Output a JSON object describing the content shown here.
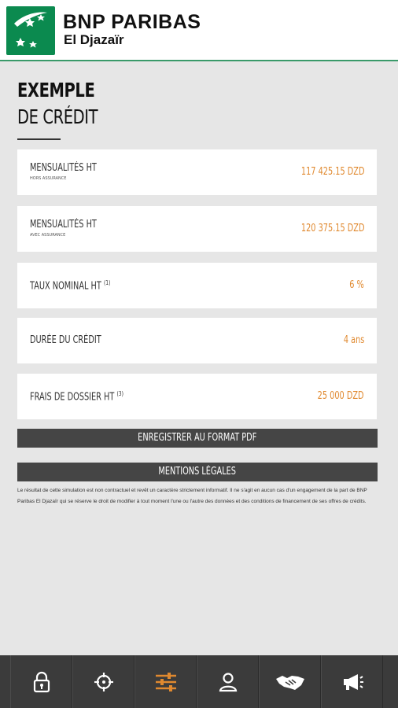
{
  "header": {
    "brand": "BNP PARIBAS",
    "subtitle": "El Djazaïr",
    "logo_icon": "bnp-stars-logo",
    "accent": "#0b8a4f"
  },
  "page": {
    "title_line1": "EXEMPLE",
    "title_line2": "DE CRÉDIT"
  },
  "results": [
    {
      "label": "Mensualités HT",
      "sublabel": "hors assurance",
      "note": "",
      "value": "117 425.15 DZD"
    },
    {
      "label": "Mensualités HT",
      "sublabel": "avec assurance",
      "note": "",
      "value": "120 375.15 DZD"
    },
    {
      "label": "Taux nominal HT",
      "sublabel": "",
      "note": "(1)",
      "value": "6 %"
    },
    {
      "label": "Durée du crédit",
      "sublabel": "",
      "note": "",
      "value": "4 ans"
    },
    {
      "label": "Frais de dossier HT",
      "sublabel": "",
      "note": "(3)",
      "value": "25 000 DZD"
    }
  ],
  "buttons": {
    "save_pdf": "Enregistrer au format PDF",
    "legal_mentions": "Mentions légales"
  },
  "legal_text": "Le résultat de cette simulation est non contractuel et revêt un caractère strictement informatif. Il ne s'agit en aucun cas d'un engagement de la part de BNP Paribas El Djazaïr qui se réserve le droit de modifier à tout moment l'une ou l'autre des données et des conditions de financement de ses offres de crédits.",
  "nav": {
    "items": [
      {
        "icon": "lock-icon",
        "active": false
      },
      {
        "icon": "crosshair-icon",
        "active": false
      },
      {
        "icon": "sliders-icon",
        "active": true
      },
      {
        "icon": "user-icon",
        "active": false
      },
      {
        "icon": "handshake-icon",
        "active": false
      },
      {
        "icon": "megaphone-icon",
        "active": false
      }
    ],
    "active_color": "#e0892f",
    "icon_color": "#ffffff"
  }
}
